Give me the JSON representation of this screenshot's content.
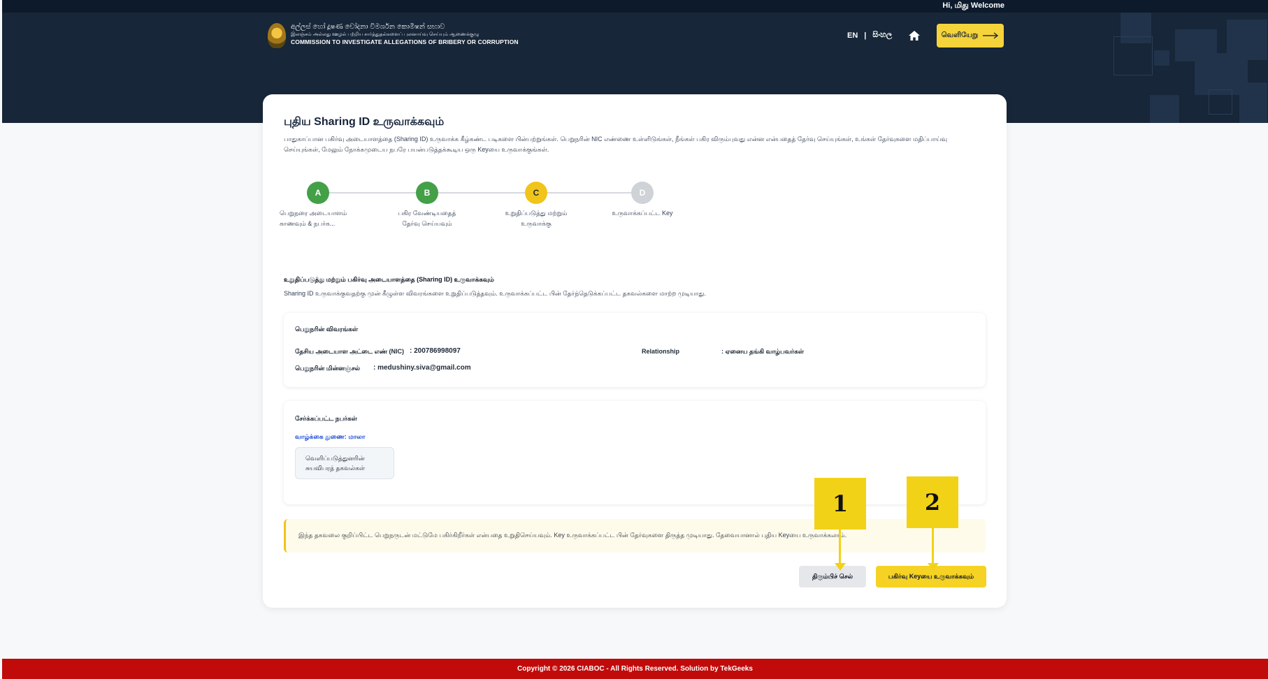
{
  "header": {
    "welcome": "Hi, மிது Welcome",
    "org_line1": "අල්ලස් හෝ දූෂණ චෝදනා විමර්ශන කොමිෂන් සභාව",
    "org_line2": "இலஞ்சம் அல்லது ஊழல் பற்றிய சார்த்துதல்களைப் புலனாய்வு செய்யும் ஆணைக்குழு",
    "org_line3": "COMMISSION TO INVESTIGATE ALLEGATIONS OF BRIBERY OR CORRUPTION",
    "lang_en": "EN",
    "lang_sep": "|",
    "lang_si": "සිංහල",
    "logout_label": "வெளியேறு",
    "icons": [
      "emblem-icon",
      "home-icon",
      "arrow-right-icon"
    ]
  },
  "page": {
    "title": "புதிய Sharing ID உருவாக்கவும்",
    "intro": "பாதுகாப்பான பகிர்வு அடையாளத்தை (Sharing ID) உருவாக்க கீழ்கண்ட படிகளை பின்பற்றுங்கள். பெறுநரின் NIC எண்ணை உள்ளிடுங்கள், நீங்கள் பகிர விரும்புவது என்ன என்பதைத் தேர்வு செய்யுங்கள், உங்கள் தேர்வுகளை மதிப்பாய்வு செய்யுங்கள், மேலும் நோக்கமுடைய நபரே பயன்படுத்தக்கூடிய ஒரு Keyயை உருவாக்குங்கள்."
  },
  "steps": [
    {
      "letter": "A",
      "label1": "பெறுநரை அடையாளம்",
      "label2": "காணவும் & நபர்க...",
      "color": "#43a047",
      "state": "done"
    },
    {
      "letter": "B",
      "label1": "பகிர வேண்டியதைத்",
      "label2": "தேர்வு செய்யவும்",
      "color": "#43a047",
      "state": "done"
    },
    {
      "letter": "C",
      "label1": "உறுதிப்படுத்து மற்றும்",
      "label2": "உருவாக்கு",
      "color": "#f0c419",
      "state": "current"
    },
    {
      "letter": "D",
      "label1": "உருவாக்கப்பட்ட Key",
      "label2": "",
      "color": "#cfd2d6",
      "state": "pending"
    }
  ],
  "confirm": {
    "title": "உறுதிப்படுத்து மற்றும் பகிர்வு அடையாளத்தை (Sharing ID) உருவாக்கவும்",
    "desc": "Sharing ID உருவாக்குவதற்கு முன் கீழுள்ள விவரங்களை உறுதிப்படுத்தவும். உருவாக்கப்பட்ட பின் தேர்ந்தெடுக்கப்பட்ட தகவல்களை மாற்ற முடியாது."
  },
  "recipient": {
    "heading": "பெறுநரின் விவரங்கள்",
    "nic_label": "தேசிய அடையாள அட்டை எண் (NIC)",
    "nic_value": ": 200786998097",
    "email_label": "பெறுநரின் மின்னஞ்சல்",
    "email_value": ": medushiny.siva@gmail.com",
    "relationship_label": "Relationship",
    "relationship_value": ": ஏனைய தங்கி வாழ்பவர்கள்"
  },
  "persons": {
    "heading": "சேர்க்கப்பட்ட நபர்கள்",
    "spouse": "வாழ்க்கை துணை: மாலா",
    "chip_line1": "வெளிப்படுத்துனரின்",
    "chip_line2": "சுயவிபரத் தகவல்கள்"
  },
  "notice": "இந்த தகவலை குறிப்பிட்ட பெறுநருடன் மட்டுமே பகிர்கிறீர்கள் என்பதை உறுதிசெய்யவும். Key உருவாக்கப்பட்ட பின் தேர்வுகளை திருத்த முடியாது. தேவையானால் புதிய Keyயை உருவாக்கலாம்.",
  "actions": {
    "back": "திரும்பிச் செல்",
    "generate": "பகிர்வு Keyயை உருவாக்கவும்"
  },
  "markers": {
    "m1": "1",
    "m2": "2"
  },
  "footer": "Copyright © 2026 CIABOC - All Rights Reserved. Solution by TekGeeks"
}
